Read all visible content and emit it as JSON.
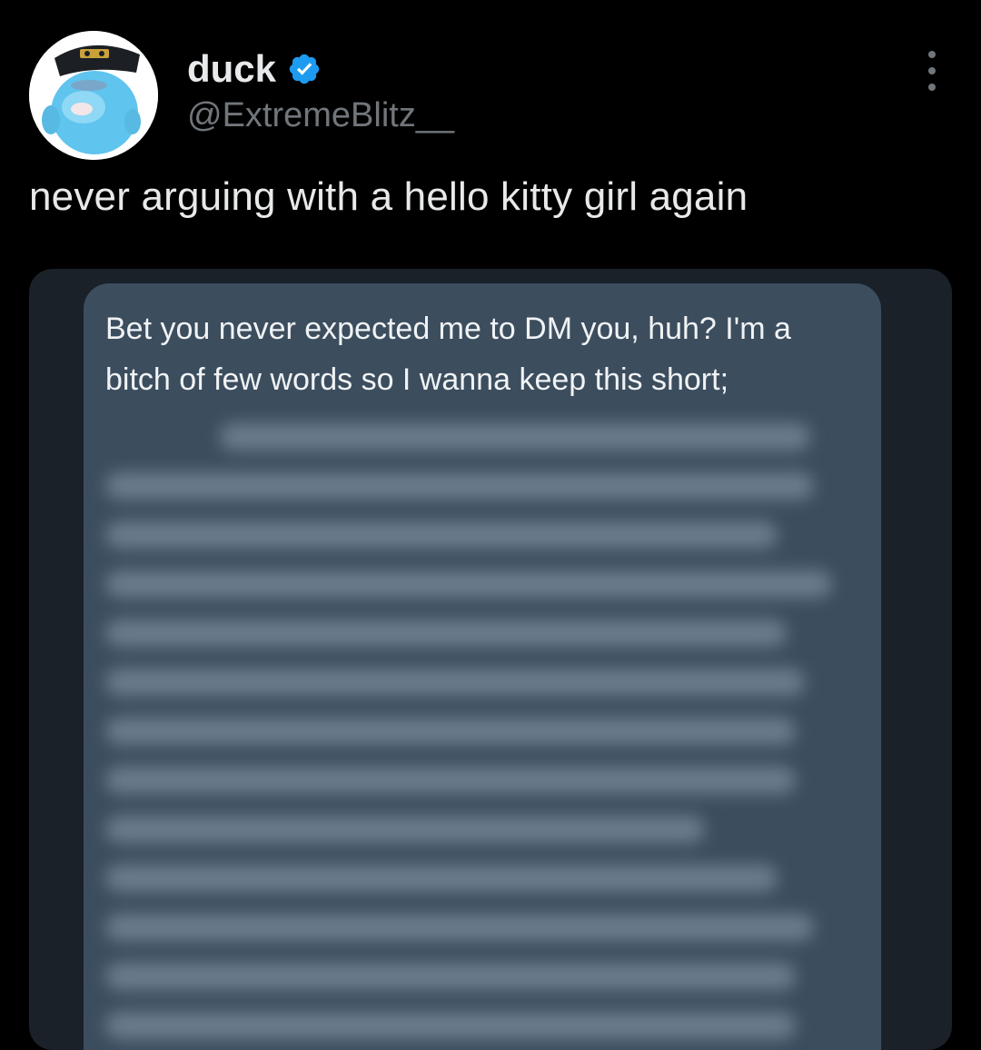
{
  "tweet": {
    "author": {
      "name": "duck",
      "handle": "@ExtremeBlitz__",
      "verified": true,
      "avatar_icon": "duck-plush-avatar"
    },
    "text": "never arguing with a hello kitty girl again",
    "more_icon": "more-options-icon"
  },
  "media": {
    "type": "dm-screenshot",
    "bubble_text": "Bet you never expected me to DM you, huh? I'm a bitch of few words so I wanna keep this short;",
    "rest_blurred": true,
    "colors": {
      "card_background": "#1a2129",
      "bubble_background": "#3c4d5e"
    }
  }
}
